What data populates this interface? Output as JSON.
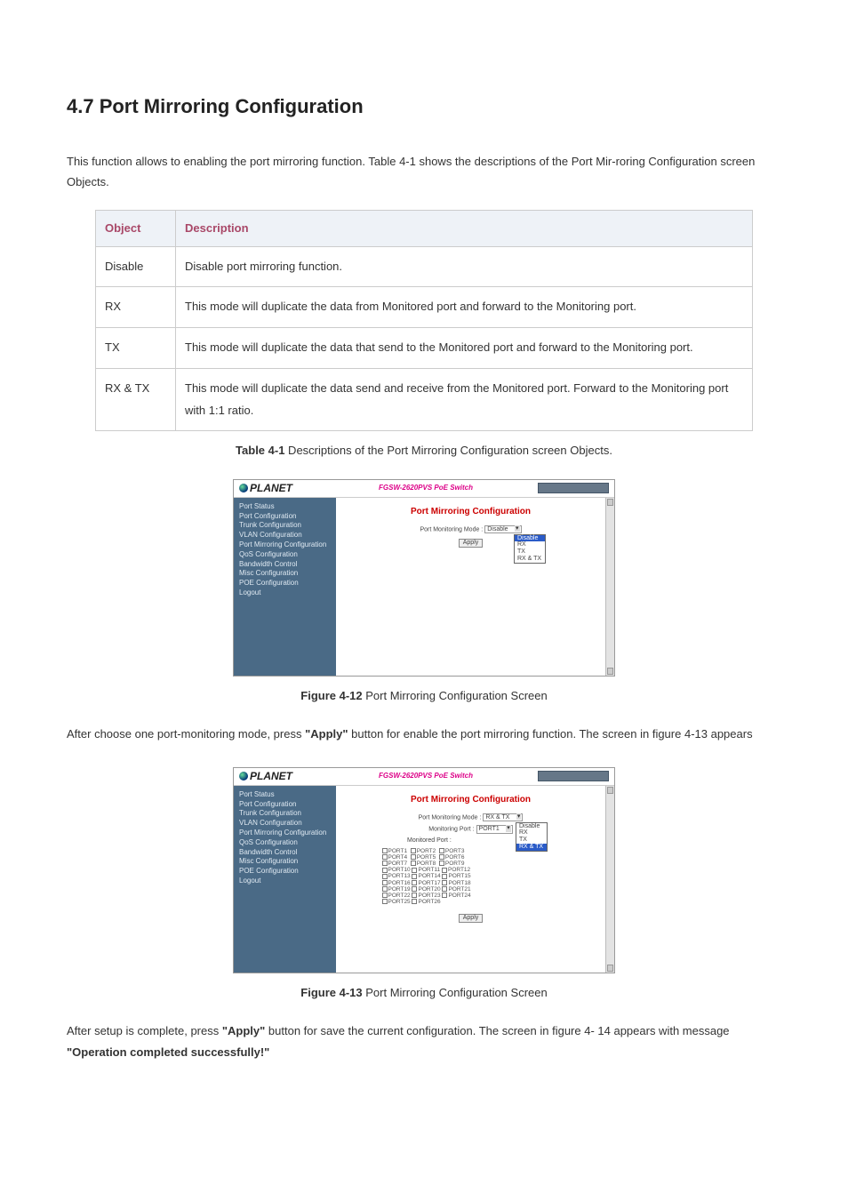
{
  "heading": "4.7 Port Mirroring Configuration",
  "intro": "This function allows to enabling the port mirroring function. Table 4-1 shows the descriptions of the Port Mir-roring Configuration screen Objects.",
  "table_headers": {
    "object": "Object",
    "description": "Description"
  },
  "table_rows": [
    {
      "object": "Disable",
      "description": "Disable port mirroring function."
    },
    {
      "object": "RX",
      "description": "This mode will duplicate the data from Monitored port and forward to the Monitoring port."
    },
    {
      "object": "TX",
      "description": "This mode will duplicate the data that send to the Monitored port and forward to the Monitoring port."
    },
    {
      "object": "RX & TX",
      "description": "This mode will duplicate the data send and receive from the Monitored port. Forward to the Monitoring port with 1:1 ratio."
    }
  ],
  "caption_table": {
    "bold": "Table 4-1",
    "rest": " Descriptions of the Port Mirroring Configuration screen Objects."
  },
  "switch_ui": {
    "logo": "PLANET",
    "model": "FGSW-2620PVS PoE Switch",
    "sidebar": [
      "Port Status",
      "Port Configuration",
      "Trunk Configuration",
      "VLAN Configuration",
      "Port Mirroring Configuration",
      "QoS Configuration",
      "Bandwidth Control",
      "Misc Configuration",
      "POE Configuration",
      "Logout"
    ],
    "panel_title": "Port Mirroring Configuration",
    "mode_label": "Port Monitoring Mode :",
    "monitoring_port_label": "Monitoring Port :",
    "monitored_port_label": "Monitored Port :",
    "apply_label": "Apply",
    "dropdown1": {
      "selected": "Disable",
      "options": [
        "Disable",
        "RX",
        "TX",
        "RX & TX"
      ]
    },
    "dropdown2_mode": {
      "selected": "RX & TX",
      "options": [
        "Disable",
        "RX",
        "TX",
        "RX & TX"
      ]
    },
    "dropdown2_port": {
      "selected": "PORT1",
      "options": [
        "RX",
        "TX",
        "RX & TX"
      ]
    },
    "ports": [
      [
        "PORT1",
        "PORT2",
        "PORT3"
      ],
      [
        "PORT4",
        "PORT5",
        "PORT6"
      ],
      [
        "PORT7",
        "PORT8",
        "PORT9"
      ],
      [
        "PORT10",
        "PORT11",
        "PORT12"
      ],
      [
        "PORT13",
        "PORT14",
        "PORT15"
      ],
      [
        "PORT16",
        "PORT17",
        "PORT18"
      ],
      [
        "PORT19",
        "PORT20",
        "PORT21"
      ],
      [
        "PORT22",
        "PORT23",
        "PORT24"
      ],
      [
        "PORT25",
        "PORT26"
      ]
    ]
  },
  "caption_fig412": {
    "bold": "Figure 4-12",
    "rest": " Port Mirroring Configuration Screen"
  },
  "para_after_412_a": "After choose one port-monitoring mode, press ",
  "para_after_412_b": "\"Apply\"",
  "para_after_412_c": " button for enable the port mirroring function. The screen in figure 4-13 appears",
  "caption_fig413": {
    "bold": "Figure 4-13",
    "rest": " Port Mirroring Configuration Screen"
  },
  "para_after_413_a": "After setup is complete, press ",
  "para_after_413_b": "\"Apply\"",
  "para_after_413_c": " button for save the current configuration. The screen in figure 4- 14 appears with message ",
  "para_after_413_d": "\"Operation completed successfully!\""
}
